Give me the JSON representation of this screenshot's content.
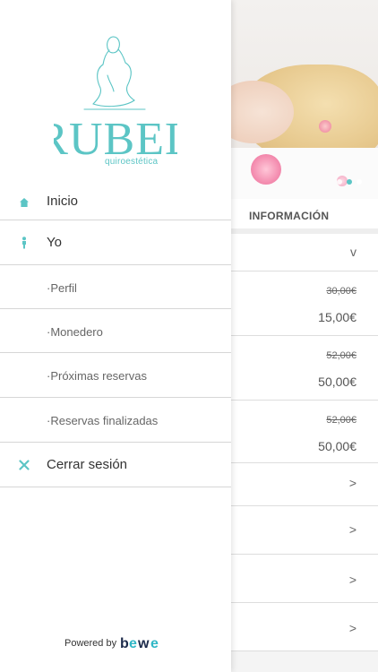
{
  "brand": {
    "name": "RUBEL",
    "tagline": "quiroestética",
    "accent_color": "#5cc5c5"
  },
  "menu": {
    "items": [
      {
        "label": "Inicio",
        "icon": "home-icon"
      },
      {
        "label": "Yo",
        "icon": "person-icon"
      },
      {
        "label": "·Perfil"
      },
      {
        "label": "·Monedero"
      },
      {
        "label": "·Próximas reservas"
      },
      {
        "label": "·Reservas finalizadas"
      },
      {
        "label": "Cerrar sesión",
        "icon": "close-icon"
      }
    ]
  },
  "footer": {
    "powered_label": "Powered by",
    "provider": "bewe"
  },
  "background": {
    "info_title": "INFORMACIÓN",
    "collapse_chevron": "v",
    "prices": [
      {
        "old": "30,00€",
        "new": "15,00€"
      },
      {
        "old": "52,00€",
        "new": "50,00€"
      },
      {
        "old": "52,00€",
        "new": "50,00€"
      }
    ],
    "row_chevron": ">"
  }
}
